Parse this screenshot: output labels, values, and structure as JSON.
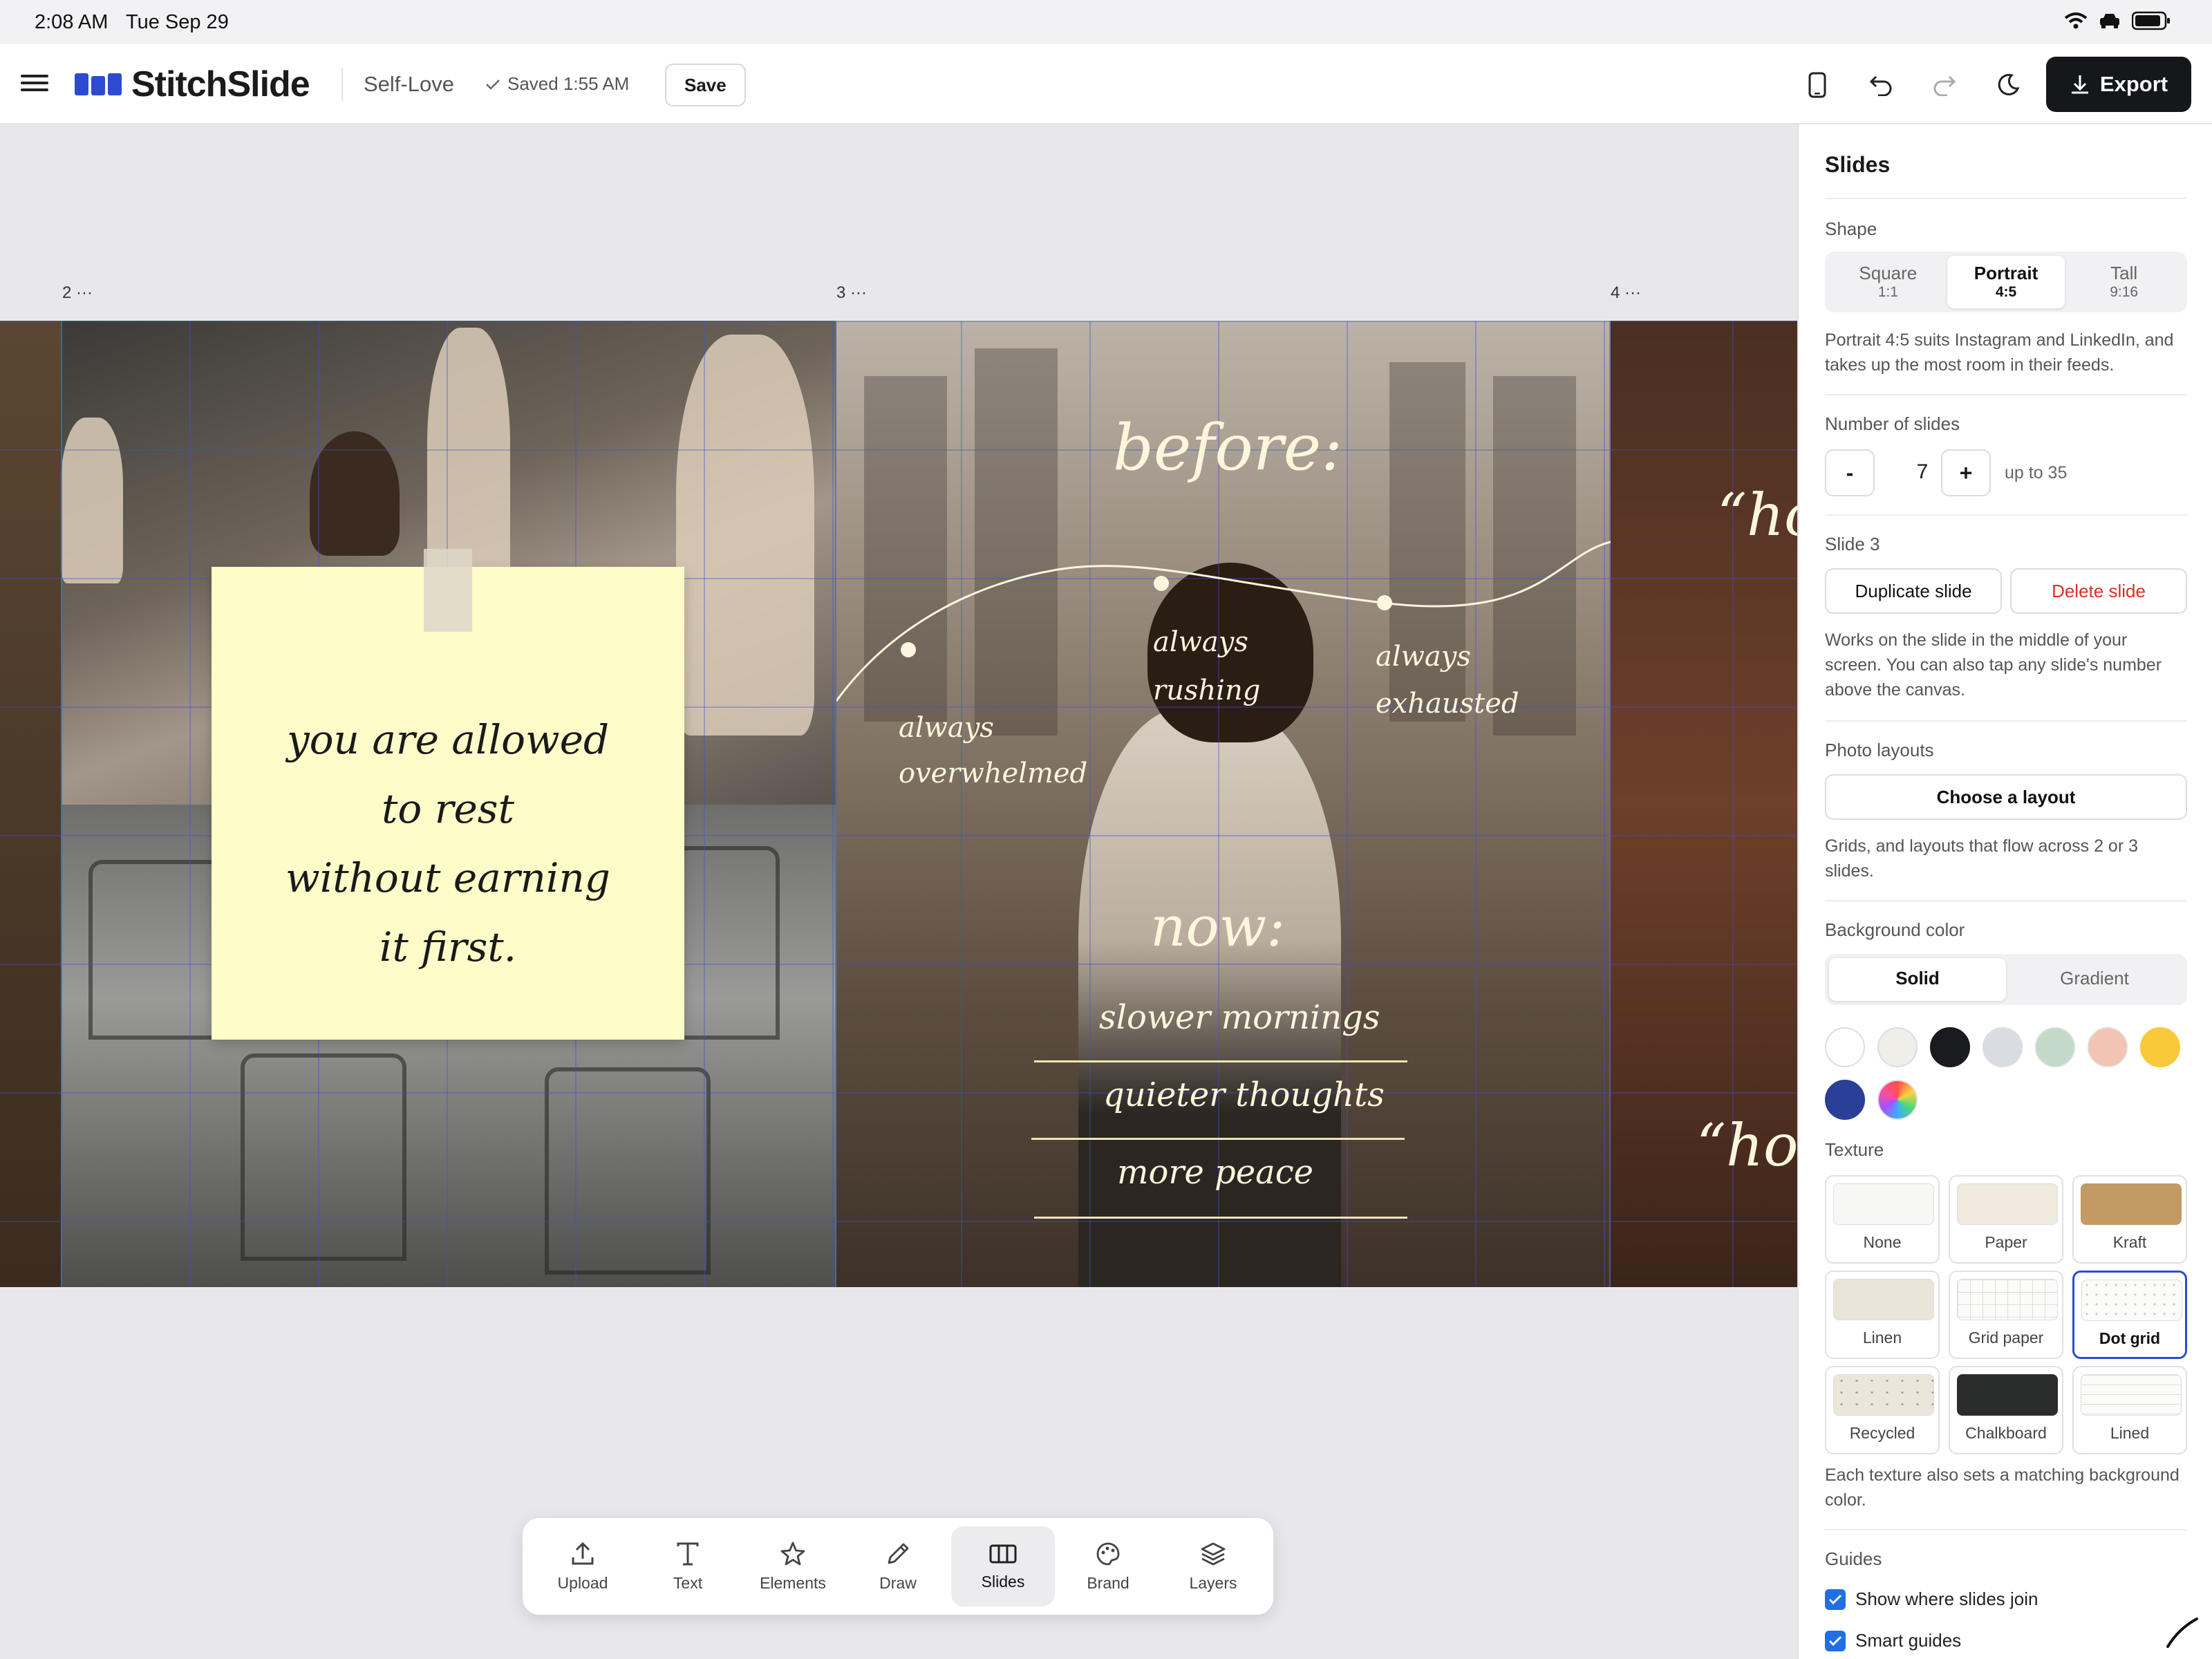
{
  "status": {
    "time": "2:08 AM",
    "date": "Tue Sep 29"
  },
  "header": {
    "app_name": "StitchSlide",
    "doc_title": "Self-Love",
    "saved": "Saved 1:55 AM",
    "save_label": "Save",
    "export_label": "Export",
    "icons": [
      "menu-icon",
      "phone-preview-icon",
      "undo-icon",
      "redo-icon",
      "dark-mode-icon",
      "download-icon"
    ]
  },
  "canvas": {
    "slide_labels": [
      "2 ···",
      "3 ···",
      "4 ···"
    ],
    "note_lines": [
      "you are allowed",
      "to rest",
      "without earning",
      "it first."
    ],
    "before": "before:",
    "always_overwhelmed_1": "always",
    "always_overwhelmed_2": "overwhelmed",
    "always_rushing_1": "always",
    "always_rushing_2": "rushing",
    "always_exhausted_1": "always",
    "always_exhausted_2": "exhausted",
    "now": "now:",
    "list": [
      "slower mornings",
      "quieter thoughts",
      "more peace"
    ],
    "right_quote_1": "“ho",
    "right_quote_2": "“how"
  },
  "panel": {
    "title": "Slides",
    "shape_heading": "Shape",
    "shapes": [
      {
        "label": "Square",
        "ratio": "1:1"
      },
      {
        "label": "Portrait",
        "ratio": "4:5"
      },
      {
        "label": "Tall",
        "ratio": "9:16"
      }
    ],
    "shape_selected": "Portrait",
    "shape_note": "Portrait 4:5 suits Instagram and LinkedIn, and takes up the most room in their feeds.",
    "count_heading": "Number of slides",
    "minus": "-",
    "count": "7",
    "plus": "+",
    "count_limit": "up to 35",
    "slide_heading": "Slide 3",
    "duplicate": "Duplicate slide",
    "delete": "Delete slide",
    "slide_note": "Works on the slide in the middle of your screen. You can also tap any slide's number above the canvas.",
    "layouts_heading": "Photo layouts",
    "choose_layout": "Choose a layout",
    "layouts_note": "Grids, and layouts that flow across 2 or 3 slides.",
    "bg_heading": "Background color",
    "bg_modes": [
      "Solid",
      "Gradient"
    ],
    "bg_selected": "Solid",
    "swatches": [
      "#ffffff",
      "#efeee9",
      "#1a1b1f",
      "#d9dde2",
      "#c4dac9",
      "#f3c3b3",
      "#f8c93a",
      "#2a3f97",
      "rainbow"
    ],
    "texture_heading": "Texture",
    "textures": [
      "None",
      "Paper",
      "Kraft",
      "Linen",
      "Grid paper",
      "Dot grid",
      "Recycled",
      "Chalkboard",
      "Lined"
    ],
    "texture_selected": "Dot grid",
    "texture_note": "Each texture also sets a matching background color.",
    "guides_heading": "Guides",
    "guide_1": "Show where slides join",
    "guide_2": "Smart guides"
  },
  "toolbar": {
    "items": [
      "Upload",
      "Text",
      "Elements",
      "Draw",
      "Slides",
      "Brand",
      "Layers"
    ],
    "selected": "Slides"
  }
}
